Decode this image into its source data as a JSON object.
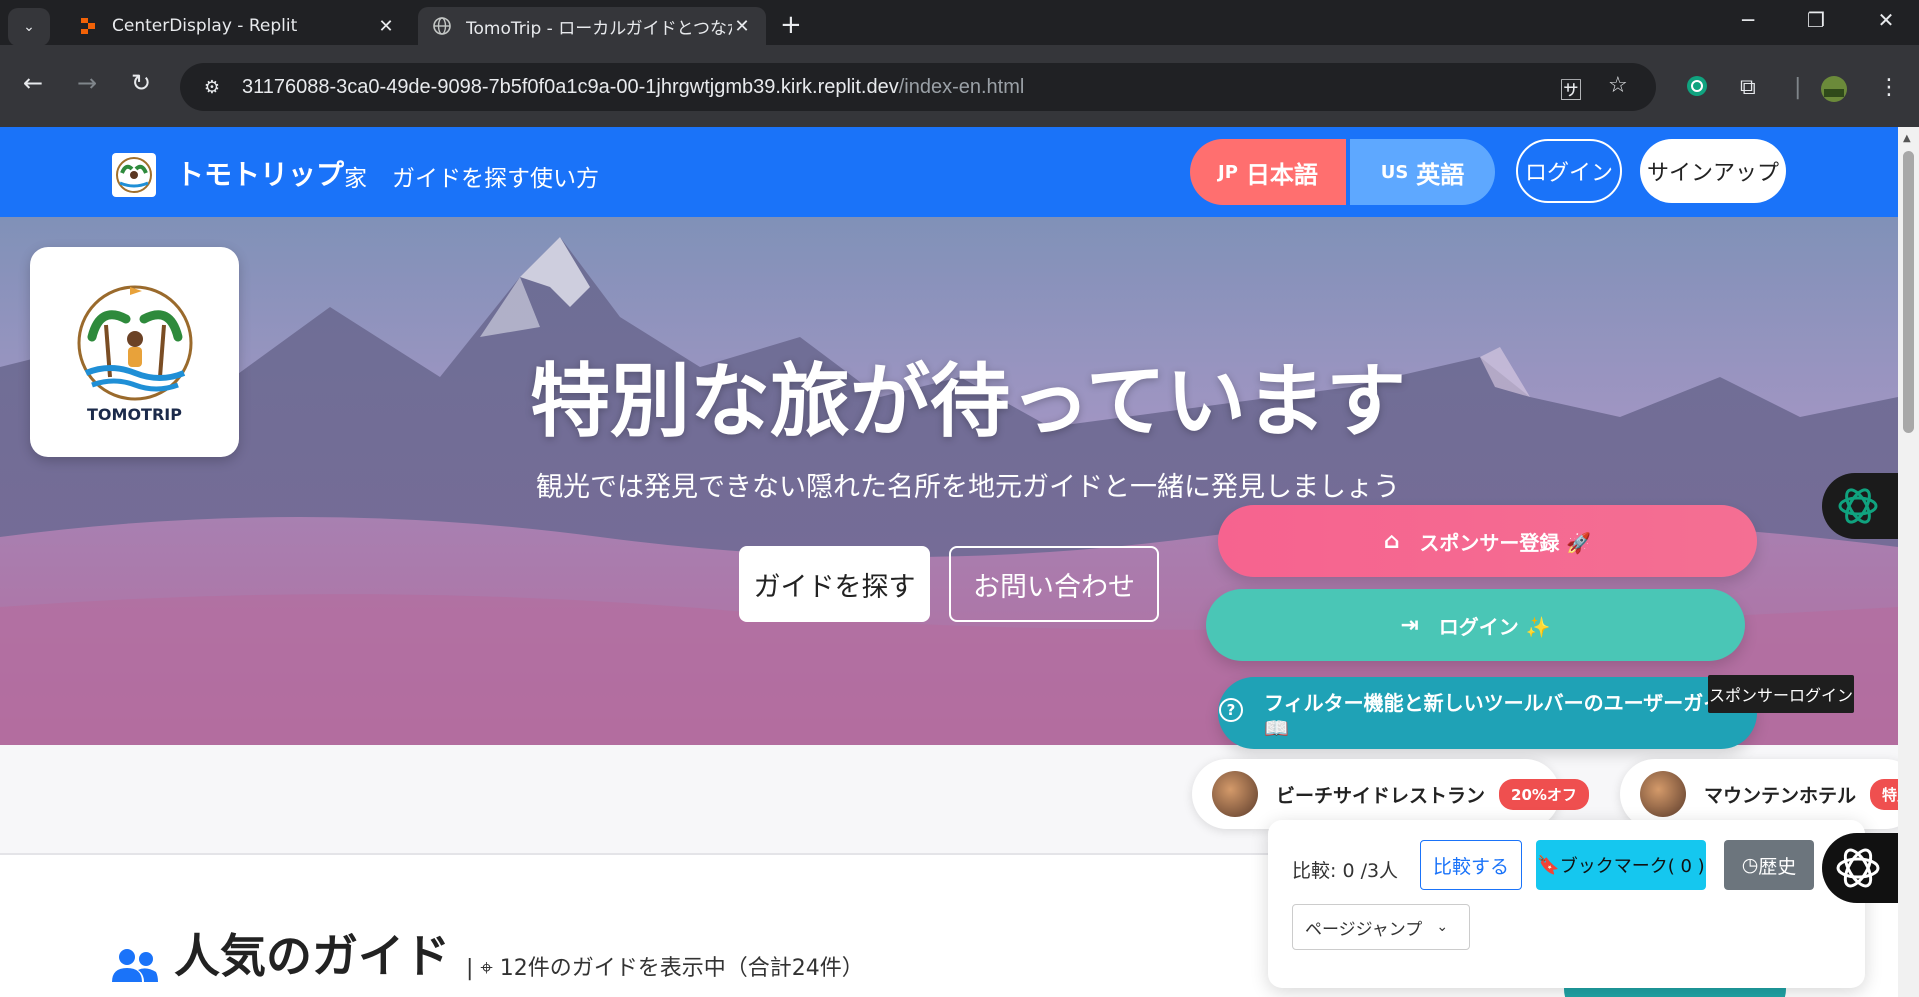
{
  "browser": {
    "tabs": [
      {
        "title": "CenterDisplay - Replit",
        "active": false
      },
      {
        "title": "TomoTrip - ローカルガイドとつながる",
        "active": true
      }
    ],
    "url_host": "31176088-3ca0-49de-9098-7b5f0f0a1c9a-00-1jhrgwtjgmb39.kirk.replit.dev",
    "url_path": "/index-en.html"
  },
  "header": {
    "brand": "トモトリップ",
    "nav": [
      "家",
      "ガイドを探す",
      "使い方"
    ],
    "lang_jp_code": "JP",
    "lang_jp": "日本語",
    "lang_us_code": "US",
    "lang_us": "英語",
    "login": "ログイン",
    "signup": "サインアップ"
  },
  "hero": {
    "logo_text": "TOMOTRIP",
    "title": "特別な旅が待っています",
    "subtitle": "観光では発見できない隠れた名所を地元ガイドと一緒に発見しましょう",
    "btn_find": "ガイドを探す",
    "btn_contact": "お問い合わせ"
  },
  "floating": {
    "sponsor_register": "スポンサー登録 🚀",
    "login": "ログイン ✨",
    "guide": "フィルター機能と新しいツールバーのユーザーガイド 📖",
    "tooltip": "スポンサーログイン"
  },
  "deals": [
    {
      "name": "ビーチサイドレストラン",
      "badge": "20%オフ"
    },
    {
      "name": "マウンテンホテル",
      "badge": "特別価"
    }
  ],
  "compare": {
    "label": "比較: 0 /3人",
    "compare_btn": "比較する",
    "bookmark_btn": "ブックマーク( 0 )",
    "history_btn": "歴史",
    "jump_select": "ページジャンプ"
  },
  "popular": {
    "title": "人気のガイド",
    "meta": "12件のガイドを表示中（合計24件）"
  },
  "colors": {
    "header_blue": "#1a73f9",
    "lang_jp": "#ff6f6f",
    "lang_us": "#5ea8ff",
    "sponsor_pink": "#f6638f",
    "login_teal": "#4ac6b6",
    "guide_teal": "#1fa2b6",
    "bookmark_cyan": "#15c7ef",
    "badge_red": "#ef4f4f"
  }
}
